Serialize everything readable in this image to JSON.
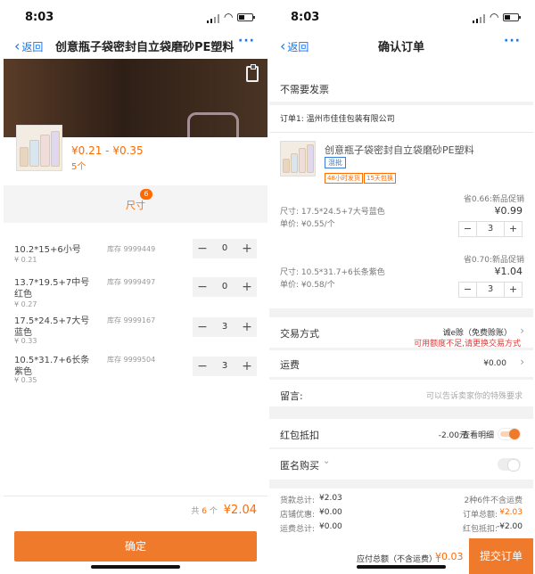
{
  "status_bar": {
    "time": "8:03"
  },
  "left_screen": {
    "nav": {
      "back_label": "返回",
      "title": "创意瓶子袋密封自立袋磨砂PE塑料",
      "more": "···"
    },
    "product": {
      "price_range": "¥0.21 - ¥0.35",
      "count": "5个"
    },
    "size_section": {
      "label": "尺寸",
      "badge": "6"
    },
    "variants": [
      {
        "name": "10.2*15+6小号",
        "price": "¥ 0.21",
        "stock": "库存 9999449",
        "qty": "0"
      },
      {
        "name": "13.7*19.5+7中号红色",
        "price": "¥ 0.27",
        "stock": "库存 9999497",
        "qty": "0"
      },
      {
        "name": "17.5*24.5+7大号蓝色",
        "price": "¥ 0.33",
        "stock": "库存 9999167",
        "qty": "3"
      },
      {
        "name": "10.5*31.7+6长条紫色",
        "price": "¥ 0.35",
        "stock": "库存 9999504",
        "qty": "3"
      }
    ],
    "stepper": {
      "minus": "−",
      "plus": "+"
    },
    "total": {
      "prefix": "共",
      "count": "6",
      "suffix": "个",
      "amount": "¥2.04"
    },
    "confirm_label": "确定"
  },
  "right_screen": {
    "nav": {
      "back_label": "返回",
      "title": "确认订单",
      "more": "···"
    },
    "invoice": "不需要发票",
    "order_label": "订单1: 温州市佳佳包装有限公司",
    "item": {
      "title": "创意瓶子袋密封自立袋磨砂PE塑料",
      "tag_mixed": "混批",
      "tag_ship": "48小时发货",
      "tag_return": "15天包换"
    },
    "skus": [
      {
        "promo": "省0.66:新品促销",
        "size": "尺寸: 17.5*24.5+7大号蓝色",
        "unit_price": "单价: ¥0.55/个",
        "price": "¥0.99",
        "qty": "3"
      },
      {
        "promo": "省0.70:新品促销",
        "size": "尺寸: 10.5*31.7+6长条紫色",
        "unit_price": "单价: ¥0.58/个",
        "price": "¥1.04",
        "qty": "3"
      }
    ],
    "stepper": {
      "minus": "−",
      "plus": "+"
    },
    "trade": {
      "label": "交易方式",
      "value": "诚e赊（免费赊账）",
      "warning": "可用额度不足,请更换交易方式"
    },
    "shipping": {
      "label": "运费",
      "value": "¥0.00"
    },
    "message": {
      "label": "留言:",
      "placeholder": "可以告诉卖家你的特殊要求"
    },
    "red_packet": {
      "label": "红包抵扣",
      "value": "-2.00元",
      "detail": "查看明细"
    },
    "anonymous": {
      "label": "匿名购买"
    },
    "summary_left": [
      {
        "label": "货款总计:",
        "value": "¥2.03"
      },
      {
        "label": "店铺优惠:",
        "value": "¥0.00"
      },
      {
        "label": "运费总计:",
        "value": "¥0.00"
      }
    ],
    "summary_right": {
      "kinds": "2种6件不含运费",
      "order_total_label": "订单总额:",
      "order_total": "¥2.03",
      "red_label": "红包抵扣:",
      "red_value": "-¥2.00"
    },
    "bottom": {
      "total_label": "应付总额（不含运费）:",
      "total": "¥0.03",
      "submit_label": "提交订单"
    }
  }
}
